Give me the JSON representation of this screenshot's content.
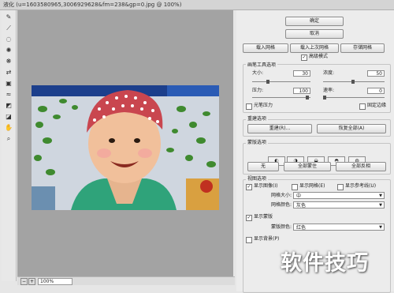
{
  "window": {
    "title": "液化 (u=1603580965,3006929628&fm=238&gp=0.jpg @ 100%)"
  },
  "tools": [
    "warp-tool",
    "reconstruct-tool",
    "twirl-tool",
    "pucker-tool",
    "bloat-tool",
    "push-left-tool",
    "mirror-tool",
    "turbulence-tool",
    "freeze-mask-tool",
    "thaw-mask-tool",
    "hand-tool",
    "zoom-tool"
  ],
  "status": {
    "zoom": "100%"
  },
  "panel": {
    "ok": "确定",
    "cancel": "取消",
    "load_mesh": "载入网格",
    "load_last_mesh": "载入上次网格",
    "save_mesh": "存储网格",
    "advanced_mode": "高级模式",
    "tool_options": {
      "title": "画笔工具选项",
      "size_label": "大小:",
      "size_value": "30",
      "density_label": "浓度:",
      "density_value": "50",
      "pressure_label": "压力:",
      "pressure_value": "100",
      "rate_label": "速率:",
      "rate_value": "0",
      "stylus_pressure": "光笔压力",
      "pin_edges": "固定边缘"
    },
    "reconstruct_options": {
      "title": "重建选项",
      "reconstruct": "重建(R)...",
      "restore_all": "恢复全部(A)"
    },
    "mask_options": {
      "title": "蒙版选项",
      "none": "无",
      "mask_all": "全部蒙住",
      "invert_all": "全部反相"
    },
    "view_options": {
      "title": "视图选项",
      "show_image": "显示图像(I)",
      "show_mesh": "显示网格(E)",
      "show_guides": "显示参考线(U)",
      "mesh_size_label": "网格大小:",
      "mesh_size_value": "中",
      "mesh_color_label": "网格颜色:",
      "mesh_color_value": "灰色",
      "show_mask": "显示蒙版",
      "mask_color_label": "蒙版颜色:",
      "mask_color_value": "红色",
      "show_backdrop": "显示背景(P)"
    }
  },
  "watermark": "软件技巧"
}
